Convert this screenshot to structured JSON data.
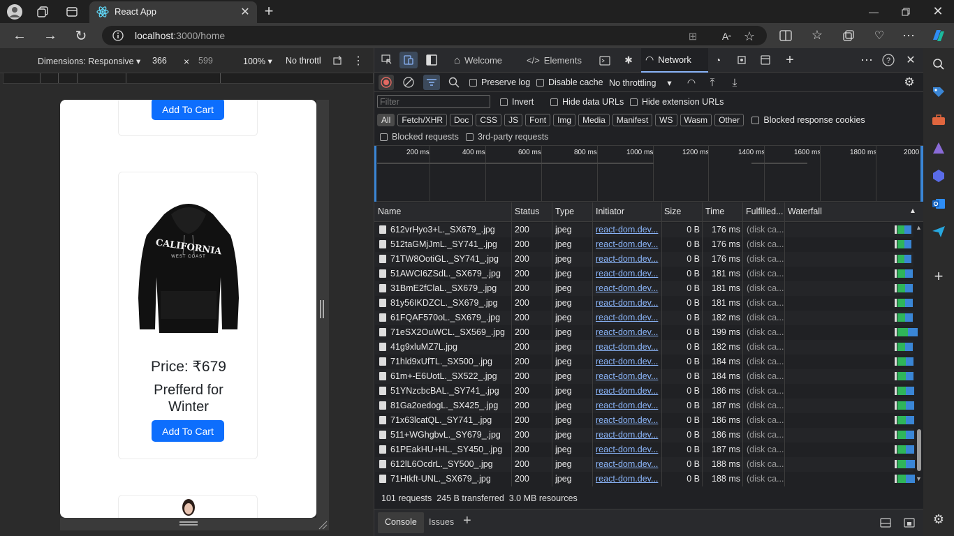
{
  "browser": {
    "tab_title": "React App",
    "url_host": "localhost",
    "url_rest": ":3000/home"
  },
  "device_toolbar": {
    "dimensions_label": "Dimensions: Responsive",
    "width": "366",
    "times": "×",
    "height": "599",
    "zoom": "100%",
    "throttle": "No throttl"
  },
  "page": {
    "top_button": "Add To Cart",
    "price": "Price: ₹679",
    "desc_line1": "Prefferd for",
    "desc_line2": "Winter",
    "add_button": "Add To Cart",
    "hoodie_text": "CALIFORNIA",
    "hoodie_sub": "WEST COAST"
  },
  "devtools": {
    "tabs": [
      "Welcome",
      "Elements",
      "Network"
    ],
    "preserve_log": "Preserve log",
    "disable_cache": "Disable cache",
    "throttling": "No throttling",
    "filter_placeholder": "Filter",
    "invert": "Invert",
    "hide_data_urls": "Hide data URLs",
    "hide_ext_urls": "Hide extension URLs",
    "type_filters": [
      "All",
      "Fetch/XHR",
      "Doc",
      "CSS",
      "JS",
      "Font",
      "Img",
      "Media",
      "Manifest",
      "WS",
      "Wasm",
      "Other"
    ],
    "blocked_cookies": "Blocked response cookies",
    "blocked_requests": "Blocked requests",
    "third_party": "3rd-party requests",
    "timeline_ticks": [
      "200 ms",
      "400 ms",
      "600 ms",
      "800 ms",
      "1000 ms",
      "1200 ms",
      "1400 ms",
      "1600 ms",
      "1800 ms",
      "2000"
    ],
    "columns": [
      "Name",
      "Status",
      "Type",
      "Initiator",
      "Size",
      "Time",
      "Fulfilled...",
      "Waterfall"
    ],
    "rows": [
      {
        "name": "612vrHyo3+L._SX679_.jpg",
        "status": "200",
        "type": "jpeg",
        "initiator": "react-dom.dev...",
        "size": "0 B",
        "time": "176 ms",
        "fulfilled": "(disk ca..."
      },
      {
        "name": "512taGMjJmL._SY741_.jpg",
        "status": "200",
        "type": "jpeg",
        "initiator": "react-dom.dev...",
        "size": "0 B",
        "time": "176 ms",
        "fulfilled": "(disk ca..."
      },
      {
        "name": "71TW8OotiGL._SY741_.jpg",
        "status": "200",
        "type": "jpeg",
        "initiator": "react-dom.dev...",
        "size": "0 B",
        "time": "176 ms",
        "fulfilled": "(disk ca..."
      },
      {
        "name": "51AWCI6ZSdL._SX679_.jpg",
        "status": "200",
        "type": "jpeg",
        "initiator": "react-dom.dev...",
        "size": "0 B",
        "time": "181 ms",
        "fulfilled": "(disk ca..."
      },
      {
        "name": "31BmE2fClaL._SX679_.jpg",
        "status": "200",
        "type": "jpeg",
        "initiator": "react-dom.dev...",
        "size": "0 B",
        "time": "181 ms",
        "fulfilled": "(disk ca..."
      },
      {
        "name": "81y56IKDZCL._SX679_.jpg",
        "status": "200",
        "type": "jpeg",
        "initiator": "react-dom.dev...",
        "size": "0 B",
        "time": "181 ms",
        "fulfilled": "(disk ca..."
      },
      {
        "name": "61FQAF570oL._SX679_.jpg",
        "status": "200",
        "type": "jpeg",
        "initiator": "react-dom.dev...",
        "size": "0 B",
        "time": "182 ms",
        "fulfilled": "(disk ca..."
      },
      {
        "name": "71eSX2OuWCL._SX569_.jpg",
        "status": "200",
        "type": "jpeg",
        "initiator": "react-dom.dev...",
        "size": "0 B",
        "time": "199 ms",
        "fulfilled": "(disk ca..."
      },
      {
        "name": "41g9xluMZ7L.jpg",
        "status": "200",
        "type": "jpeg",
        "initiator": "react-dom.dev...",
        "size": "0 B",
        "time": "182 ms",
        "fulfilled": "(disk ca..."
      },
      {
        "name": "71hld9xUfTL._SX500_.jpg",
        "status": "200",
        "type": "jpeg",
        "initiator": "react-dom.dev...",
        "size": "0 B",
        "time": "184 ms",
        "fulfilled": "(disk ca..."
      },
      {
        "name": "61m+-E6UotL._SX522_.jpg",
        "status": "200",
        "type": "jpeg",
        "initiator": "react-dom.dev...",
        "size": "0 B",
        "time": "184 ms",
        "fulfilled": "(disk ca..."
      },
      {
        "name": "51YNzcbcBAL._SY741_.jpg",
        "status": "200",
        "type": "jpeg",
        "initiator": "react-dom.dev...",
        "size": "0 B",
        "time": "186 ms",
        "fulfilled": "(disk ca..."
      },
      {
        "name": "81Ga2oedogL._SX425_.jpg",
        "status": "200",
        "type": "jpeg",
        "initiator": "react-dom.dev...",
        "size": "0 B",
        "time": "187 ms",
        "fulfilled": "(disk ca..."
      },
      {
        "name": "71x63lcatQL._SY741_.jpg",
        "status": "200",
        "type": "jpeg",
        "initiator": "react-dom.dev...",
        "size": "0 B",
        "time": "186 ms",
        "fulfilled": "(disk ca..."
      },
      {
        "name": "511+WGhgbvL._SY679_.jpg",
        "status": "200",
        "type": "jpeg",
        "initiator": "react-dom.dev...",
        "size": "0 B",
        "time": "186 ms",
        "fulfilled": "(disk ca..."
      },
      {
        "name": "61PEakHU+HL._SY450_.jpg",
        "status": "200",
        "type": "jpeg",
        "initiator": "react-dom.dev...",
        "size": "0 B",
        "time": "187 ms",
        "fulfilled": "(disk ca..."
      },
      {
        "name": "612lL6OcdrL._SY500_.jpg",
        "status": "200",
        "type": "jpeg",
        "initiator": "react-dom.dev...",
        "size": "0 B",
        "time": "188 ms",
        "fulfilled": "(disk ca..."
      },
      {
        "name": "71Htkft-UNL._SX679_.jpg",
        "status": "200",
        "type": "jpeg",
        "initiator": "react-dom.dev...",
        "size": "0 B",
        "time": "188 ms",
        "fulfilled": "(disk ca..."
      }
    ],
    "summary": "101 requests  245 B transferred  3.0 MB resources",
    "drawer_tabs": [
      "Console",
      "Issues"
    ]
  },
  "colors": {
    "accent": "#0d6efd",
    "link": "#8ab4f8",
    "wf_green": "#2fb55a",
    "wf_blue": "#3a86d6"
  }
}
